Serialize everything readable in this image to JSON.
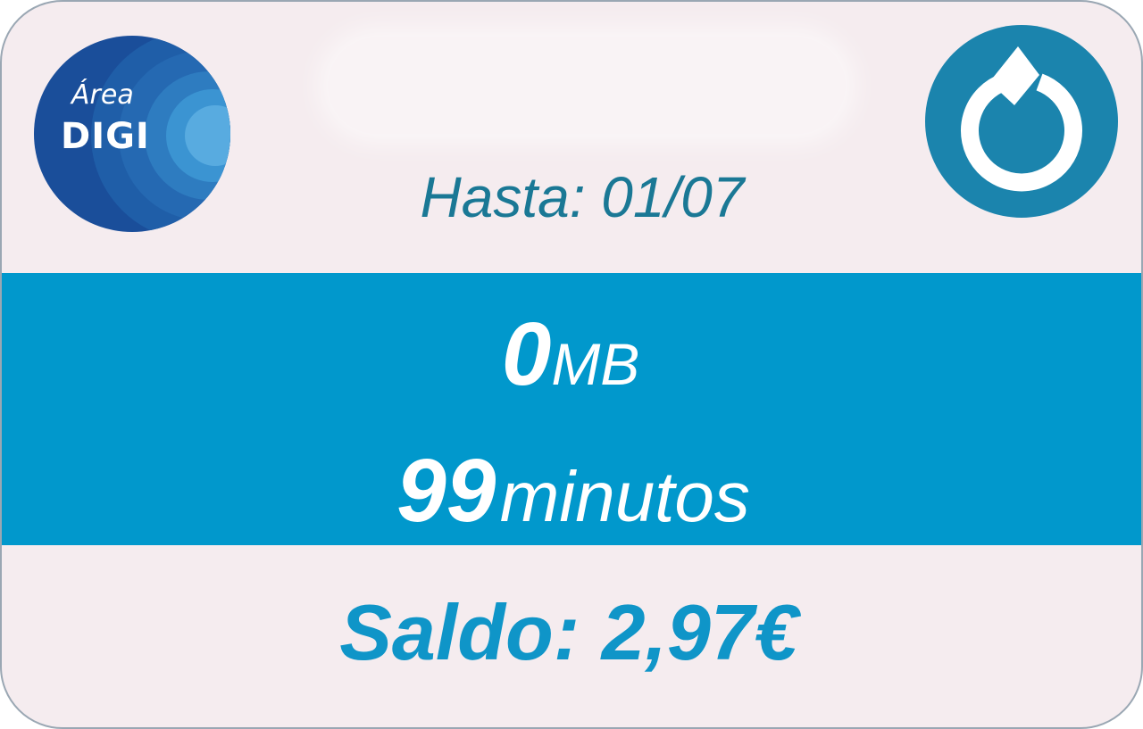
{
  "logo": {
    "line1": "Área",
    "line2": "DIGI",
    "icon": "area-digi-logo"
  },
  "refresh": {
    "icon": "refresh-icon"
  },
  "validity": {
    "label": "Hasta: 01/07"
  },
  "usage": {
    "data_value": "0",
    "data_unit": "MB",
    "minutes_value": "99",
    "minutes_unit": "minutos"
  },
  "balance": {
    "label": "Saldo: 2,97€"
  },
  "colors": {
    "background": "#f5ecef",
    "band": "#0198cc",
    "refresh_bg": "#1b84ad",
    "validity_text": "#1a7895",
    "balance_text": "#0f95c8",
    "logo_dark": "#1a4c96",
    "logo_light": "#3a9cd6"
  }
}
